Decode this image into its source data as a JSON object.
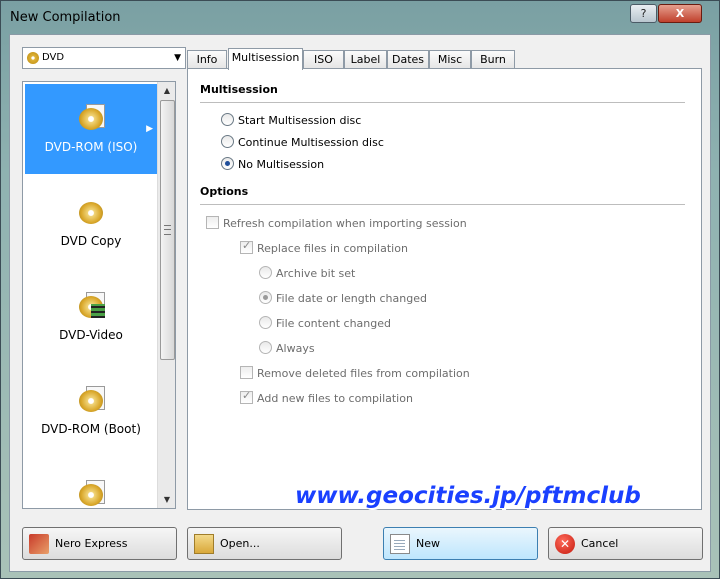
{
  "window": {
    "title": "New Compilation",
    "help_label": "?",
    "close_label": "X"
  },
  "media_combo": {
    "value": "DVD",
    "arrow": "▼"
  },
  "sidebar": {
    "items": [
      {
        "label": "DVD-ROM (ISO)",
        "icon": "dvd-rom-iso-icon",
        "selected": true
      },
      {
        "label": "DVD Copy",
        "icon": "dvd-copy-icon",
        "selected": false
      },
      {
        "label": "DVD-Video",
        "icon": "dvd-video-icon",
        "selected": false
      },
      {
        "label": "DVD-ROM (Boot)",
        "icon": "dvd-rom-boot-icon",
        "selected": false
      },
      {
        "label": "",
        "icon": "dvd-icon",
        "selected": false
      }
    ],
    "scroll_up": "▲",
    "scroll_down": "▼",
    "selected_arrow": "▶"
  },
  "tabs": [
    {
      "label": "Info"
    },
    {
      "label": "Multisession",
      "active": true
    },
    {
      "label": "ISO"
    },
    {
      "label": "Label"
    },
    {
      "label": "Dates"
    },
    {
      "label": "Misc"
    },
    {
      "label": "Burn"
    }
  ],
  "multisession": {
    "heading": "Multisession",
    "options": [
      {
        "label": "Start Multisession disc",
        "checked": false
      },
      {
        "label": "Continue Multisession disc",
        "checked": false
      },
      {
        "label": "No Multisession",
        "checked": true
      }
    ]
  },
  "options": {
    "heading": "Options",
    "refresh_label": "Refresh compilation when importing session",
    "replace_label": "Replace files in compilation",
    "archive_label": "Archive bit set",
    "file_date_label": "File date or length changed",
    "file_content_label": "File content changed",
    "always_label": "Always",
    "remove_deleted_label": "Remove deleted files from compilation",
    "add_new_label": "Add new files to compilation"
  },
  "watermark": "www.geocities.jp/pftmclub",
  "buttons": {
    "nero_express": "Nero Express",
    "open": "Open...",
    "new": "New",
    "cancel": "Cancel"
  },
  "colors": {
    "selection": "#3399ff",
    "watermark": "#1a40ff"
  }
}
